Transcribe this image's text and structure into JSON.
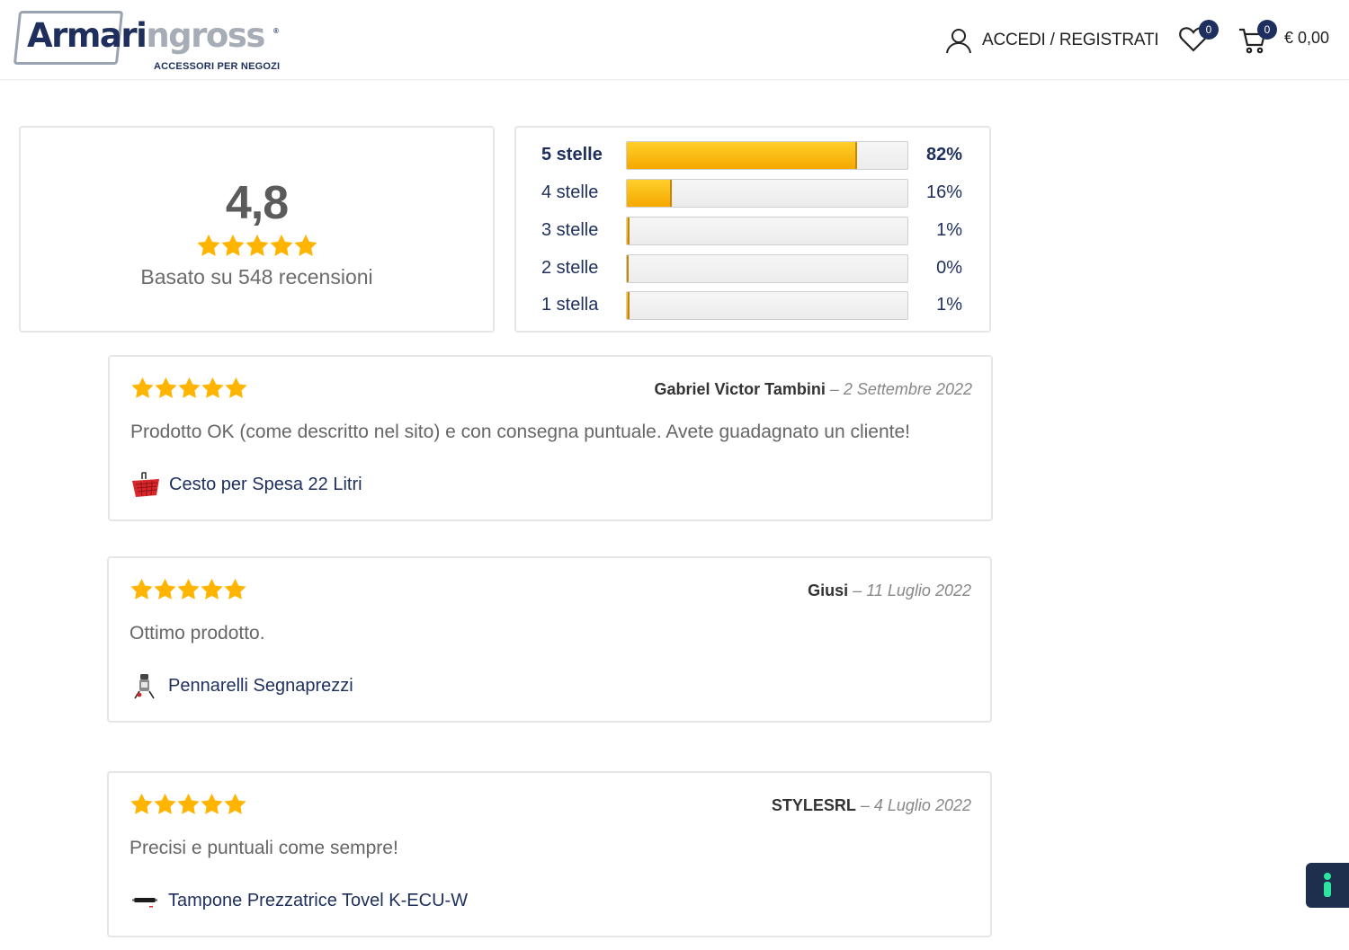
{
  "header": {
    "logo": {
      "part1": "Armari",
      "part2": "ngross",
      "registered": "®",
      "tagline": "ACCESSORI PER NEGOZI"
    },
    "account_label": "ACCEDI / REGISTRATI",
    "wishlist_count": "0",
    "cart_count": "0",
    "cart_total": "€ 0,00"
  },
  "summary": {
    "average": "4,8",
    "rating": 5,
    "based_on": "Basato su 548 recensioni"
  },
  "distribution": [
    {
      "label": "5 stelle",
      "percent": 82,
      "percent_label": "82%"
    },
    {
      "label": "4 stelle",
      "percent": 16,
      "percent_label": "16%"
    },
    {
      "label": "3 stelle",
      "percent": 1,
      "percent_label": "1%"
    },
    {
      "label": "2 stelle",
      "percent": 0,
      "percent_label": "0%"
    },
    {
      "label": "1 stella",
      "percent": 1,
      "percent_label": "1%"
    }
  ],
  "reviews": [
    {
      "rating": 5,
      "author": "Gabriel Victor Tambini",
      "separator": "–",
      "date": "2 Settembre 2022",
      "text": "Prodotto OK (come descritto nel sito) e con consegna puntuale. Avete guadagnato un cliente!",
      "product": "Cesto per Spesa 22 Litri",
      "product_icon": "shopping-basket-icon"
    },
    {
      "rating": 5,
      "author": "Giusi",
      "separator": "–",
      "date": "11 Luglio 2022",
      "text": "Ottimo prodotto.",
      "product": "Pennarelli Segnaprezzi",
      "product_icon": "marker-pen-icon"
    },
    {
      "rating": 5,
      "author": "STYLESRL",
      "separator": "–",
      "date": "4 Luglio 2022",
      "text": "Precisi e puntuali come sempre!",
      "product": "Tampone Prezzatrice Tovel K-ECU-W",
      "product_icon": "ink-roller-icon"
    }
  ],
  "colors": {
    "brand_navy": "#1e2f5e",
    "brand_grey": "#a7adb7",
    "star": "#ffb400",
    "bar_fill": "#f5a800"
  }
}
